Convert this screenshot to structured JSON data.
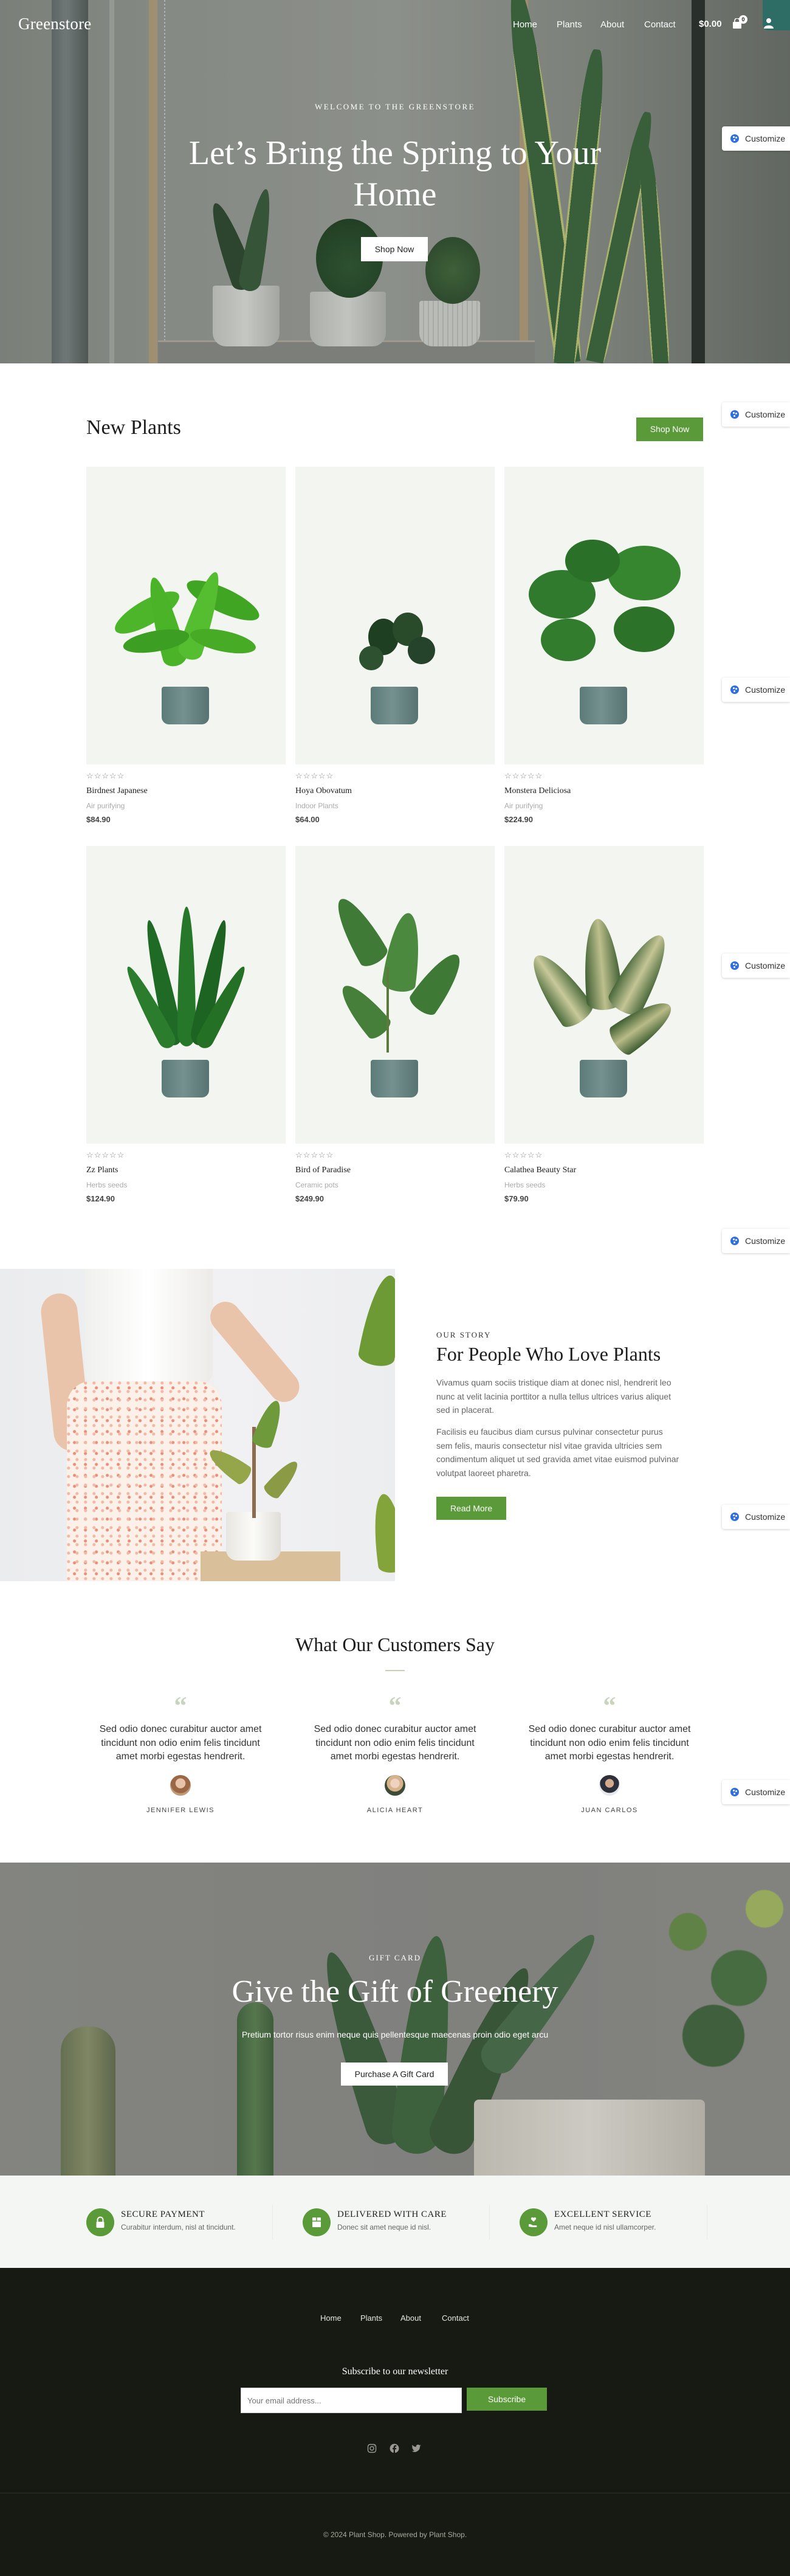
{
  "header": {
    "logo": "Greenstore",
    "nav": [
      "Home",
      "Plants",
      "About",
      "Contact"
    ],
    "cart_total": "$0.00",
    "cart_count": "0",
    "icons": {
      "cart": "shopping-bag-icon",
      "account": "user-icon"
    }
  },
  "hero": {
    "eyebrow": "WELCOME TO THE GREENSTORE",
    "title": "Let’s Bring the Spring to Your Home",
    "button": "Shop Now"
  },
  "customize": {
    "label": "Customize",
    "icon": "palette-icon"
  },
  "new_plants": {
    "title": "New Plants",
    "button": "Shop Now",
    "products": [
      {
        "name": "Birdnest Japanese",
        "category": "Air purifying",
        "price": "$84.90",
        "rating": 0
      },
      {
        "name": "Hoya Obovatum",
        "category": "Indoor Plants",
        "price": "$64.00",
        "rating": 0
      },
      {
        "name": "Monstera Deliciosa",
        "category": "Air purifying",
        "price": "$224.90",
        "rating": 0
      },
      {
        "name": "Zz Plants",
        "category": "Herbs seeds",
        "price": "$124.90",
        "rating": 0
      },
      {
        "name": "Bird of Paradise",
        "category": "Ceramic pots",
        "price": "$249.90",
        "rating": 0
      },
      {
        "name": "Calathea Beauty Star",
        "category": "Herbs seeds",
        "price": "$79.90",
        "rating": 0
      }
    ]
  },
  "story": {
    "eyebrow": "OUR STORY",
    "title": "For People Who Love Plants",
    "paragraphs": [
      "Vivamus quam sociis tristique diam at donec nisl, hendrerit leo nunc at velit lacinia porttitor a nulla tellus ultrices varius aliquet sed in placerat.",
      "Facilisis eu faucibus diam cursus pulvinar consectetur purus sem felis, mauris consectetur nisl vitae gravida ultricies sem condimentum aliquet ut sed gravida amet vitae euismod pulvinar volutpat laoreet pharetra."
    ],
    "button": "Read More"
  },
  "testimonials": {
    "title": "What Our Customers Say",
    "items": [
      {
        "quote_mark": "“",
        "text": "Sed odio donec curabitur auctor amet tincidunt non odio enim felis tincidunt amet morbi egestas hendrerit.",
        "name": "JENNIFER LEWIS"
      },
      {
        "quote_mark": "“",
        "text": "Sed odio donec curabitur auctor amet tincidunt non odio enim felis tincidunt amet morbi egestas hendrerit.",
        "name": "ALICIA HEART"
      },
      {
        "quote_mark": "“",
        "text": "Sed odio donec curabitur auctor amet tincidunt non odio enim felis tincidunt amet morbi egestas hendrerit.",
        "name": "JUAN CARLOS"
      }
    ]
  },
  "gift": {
    "eyebrow": "GIFT CARD",
    "title": "Give the Gift of Greenery",
    "subtitle": "Pretium tortor risus enim neque quis pellentesque maecenas proin odio eget arcu",
    "button": "Purchase A Gift Card"
  },
  "features": [
    {
      "icon": "lock-icon",
      "title": "SECURE PAYMENT",
      "desc": "Curabitur interdum, nisl at tincidunt."
    },
    {
      "icon": "box-icon",
      "title": "DELIVERED WITH CARE",
      "desc": "Donec sit amet neque id nisl."
    },
    {
      "icon": "hand-heart-icon",
      "title": "EXCELLENT SERVICE",
      "desc": "Amet neque id nisl ullamcorper."
    }
  ],
  "footer": {
    "nav": [
      "Home",
      "Plants",
      "About",
      "Contact"
    ],
    "newsletter_title": "Subscribe to our newsletter",
    "email_placeholder": "Your email address...",
    "subscribe": "Subscribe",
    "social": [
      "instagram-icon",
      "facebook-icon",
      "twitter-icon"
    ],
    "copyright": "© 2024 Plant Shop. Powered by Plant Shop."
  },
  "colors": {
    "accent": "#5a9a38",
    "footer_bg": "#161a12",
    "features_bg": "#f4f6f3",
    "card_bg": "#f3f5f1"
  }
}
